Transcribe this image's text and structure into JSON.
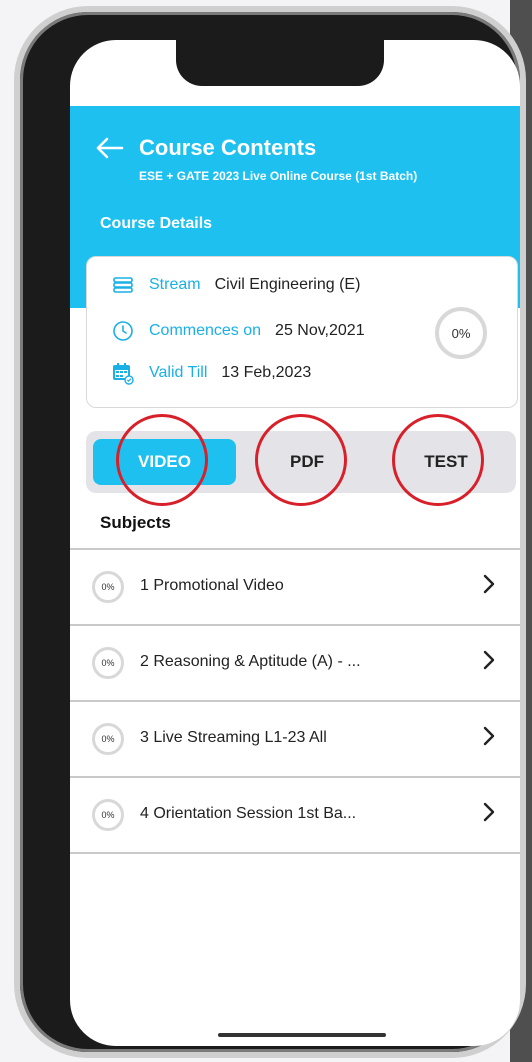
{
  "header": {
    "title": "Course Contents",
    "subtitle": "ESE + GATE 2023 Live Online Course (1st Batch)",
    "section_title": "Course Details"
  },
  "details": {
    "stream_label": "Stream",
    "stream_value": "Civil Engineering (E)",
    "commences_label": "Commences on",
    "commences_value": "25 Nov,2021",
    "valid_label": "Valid Till",
    "valid_value": "13 Feb,2023",
    "progress": "0%"
  },
  "tabs": [
    {
      "label": "VIDEO",
      "active": true
    },
    {
      "label": "PDF",
      "active": false
    },
    {
      "label": "TEST",
      "active": false
    }
  ],
  "subjects_heading": "Subjects",
  "subjects": [
    {
      "progress": "0%",
      "title": "1  Promotional Video"
    },
    {
      "progress": "0%",
      "title": "2  Reasoning & Aptitude (A) - ..."
    },
    {
      "progress": "0%",
      "title": "3  Live Streaming L1-23 All"
    },
    {
      "progress": "0%",
      "title": "4  Orientation Session 1st Ba..."
    }
  ],
  "colors": {
    "accent": "#1ec0f0",
    "annotation": "#d8202a"
  },
  "icons": [
    "back-arrow-icon",
    "books-icon",
    "clock-icon",
    "calendar-icon",
    "chevron-right-icon"
  ]
}
